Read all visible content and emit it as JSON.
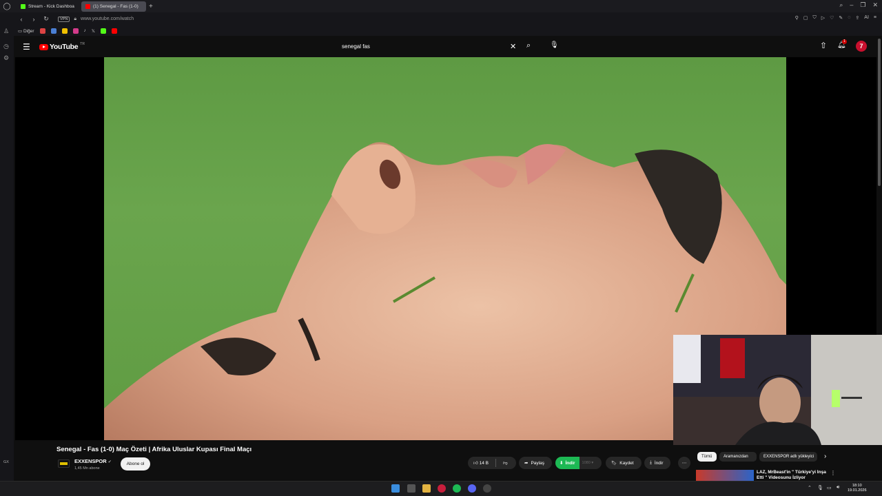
{
  "browser": {
    "tabs": [
      {
        "label": "Stream - Kick Dashboa",
        "favicon_color": "#53fc18"
      },
      {
        "label": "(1) Senegal - Fas (1-0)",
        "favicon_color": "#ff0000",
        "active": true
      }
    ],
    "address_bar": {
      "vpn_label": "VPN",
      "url": "www.youtube.com/watch"
    },
    "ai_label": "AI",
    "bookmarks": {
      "folder_label": "Diğer"
    }
  },
  "youtube": {
    "logo_text": "YouTube",
    "region": "TR",
    "search": {
      "query": "senegal fas"
    },
    "notifications_count": "1",
    "avatar_letter": "7"
  },
  "video": {
    "title": "Senegal - Fas (1-0) Maç Özeti | Afrika Uluslar Kupası Final Maçı",
    "channel": {
      "name": "EXXENSPOR",
      "subscribers": "1,45 Mn abone",
      "verified": true
    },
    "subscribe_label": "Abone ol",
    "likes": "14 B",
    "share_label": "Paylaş",
    "download_ext_label": "İndir",
    "download_quality": "1080",
    "save_label": "Kaydet",
    "download_label": "İndir"
  },
  "chips": [
    {
      "label": "Tümü",
      "active": true
    },
    {
      "label": "Aramanızdan"
    },
    {
      "label": "EXXENSPOR adlı yükleyici"
    }
  ],
  "recommendation": {
    "title": "LAZ, MrBeast'in \" Türkiye'yi İnşa Etti \" Videosunu İzliyor"
  },
  "taskbar": {
    "time": "18:10",
    "date": "19.01.2026"
  },
  "sidebar": {
    "gx_label": "GX"
  },
  "colors": {
    "youtube_red": "#ff0000",
    "download_green": "#1db954",
    "background": "#0f0f0f"
  }
}
